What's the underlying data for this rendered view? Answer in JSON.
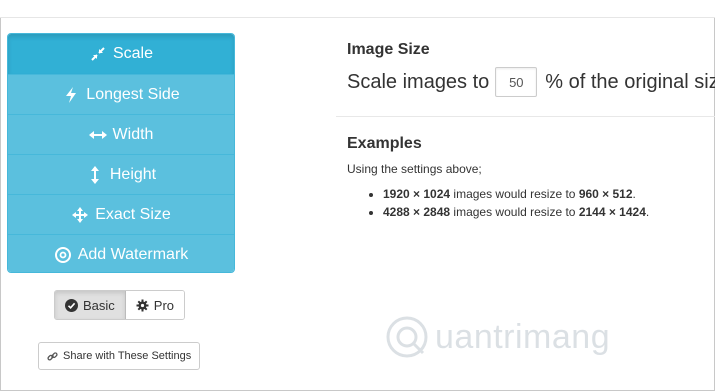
{
  "menu": {
    "items": [
      {
        "label": "Scale",
        "icon": "compress-arrows-icon",
        "active": true
      },
      {
        "label": "Longest Side",
        "icon": "bolt-icon",
        "active": false
      },
      {
        "label": "Width",
        "icon": "horizontal-arrows-icon",
        "active": false
      },
      {
        "label": "Height",
        "icon": "vertical-arrows-icon",
        "active": false
      },
      {
        "label": "Exact Size",
        "icon": "move-arrows-icon",
        "active": false
      },
      {
        "label": "Add Watermark",
        "icon": "copyright-circle-icon",
        "active": false
      }
    ]
  },
  "mode": {
    "basic_label": "Basic",
    "pro_label": "Pro",
    "selected": "Basic"
  },
  "share": {
    "label": "Share with These Settings"
  },
  "image_size": {
    "heading": "Image Size",
    "prefix": "Scale images to",
    "value": "50",
    "suffix": "% of the original size."
  },
  "examples": {
    "heading": "Examples",
    "intro": "Using the settings above;",
    "items": [
      {
        "from": "1920 × 1024",
        "middle": " images would resize to ",
        "to": "960 × 512",
        "end": "."
      },
      {
        "from": "4288 × 2848",
        "middle": " images would resize to ",
        "to": "2144 × 1424",
        "end": "."
      }
    ]
  },
  "watermark": {
    "text": "uantrimang"
  },
  "colors": {
    "menu": "#5bc0de",
    "menu_active": "#31b0d5"
  }
}
